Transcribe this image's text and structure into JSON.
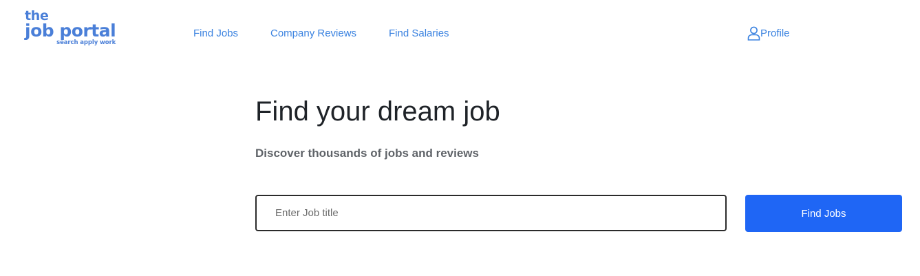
{
  "logo": {
    "line1": "the",
    "line2": "job portal",
    "tagline": "search apply work",
    "color": "#4a7fd8"
  },
  "nav": {
    "find_jobs": "Find Jobs",
    "company_reviews": "Company Reviews",
    "find_salaries": "Find Salaries",
    "profile": "Profile",
    "profile_icon": "user-icon",
    "link_color": "#3a82e0"
  },
  "hero": {
    "title": "Find your dream job",
    "subtitle": "Discover thousands of jobs and reviews"
  },
  "search": {
    "placeholder": "Enter Job title",
    "value": "",
    "button_label": "Find Jobs",
    "button_color": "#1f66f5"
  }
}
